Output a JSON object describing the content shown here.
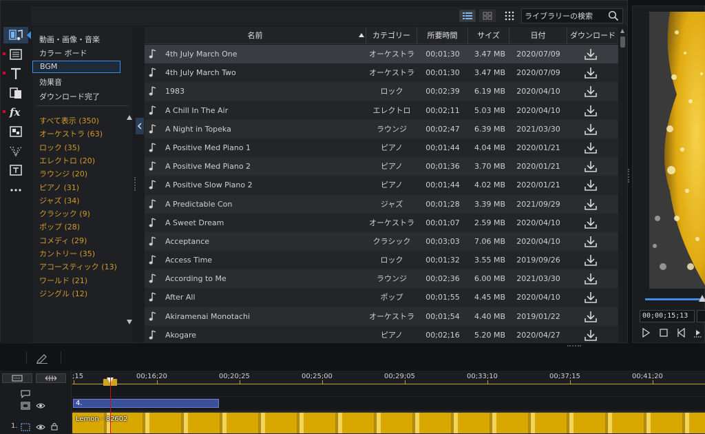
{
  "search": {
    "placeholder": "ライブラリーの検索"
  },
  "categories": {
    "main": [
      "動画・画像・音楽",
      "カラー ボード",
      "BGM",
      "効果音",
      "ダウンロード完了"
    ],
    "selected_index": 2,
    "genres": [
      "すべて表示 (350)",
      "オーケストラ (63)",
      "ロック (35)",
      "エレクトロ (20)",
      "ラウンジ (20)",
      "ピアノ (31)",
      "ジャズ (34)",
      "クラシック (9)",
      "ポップ (28)",
      "コメディ (29)",
      "カントリー (35)",
      "アコースティック (13)",
      "ワールド (21)",
      "ジングル (12)"
    ]
  },
  "table": {
    "headers": {
      "name": "名前",
      "category": "カテゴリー",
      "duration": "所要時間",
      "size": "サイズ",
      "date": "日付",
      "download": "ダウンロード"
    },
    "rows": [
      {
        "name": "4th July March One",
        "category": "オーケストラ",
        "duration": "00;01;30",
        "size": "3.47 MB",
        "date": "2020/07/09"
      },
      {
        "name": "4th July March Two",
        "category": "オーケストラ",
        "duration": "00;01;30",
        "size": "3.47 MB",
        "date": "2020/07/09"
      },
      {
        "name": "1983",
        "category": "ロック",
        "duration": "00;02;39",
        "size": "6.19 MB",
        "date": "2020/04/10"
      },
      {
        "name": "A Chill In The Air",
        "category": "エレクトロ",
        "duration": "00;02;11",
        "size": "5.03 MB",
        "date": "2020/04/10"
      },
      {
        "name": "A Night in Topeka",
        "category": "ラウンジ",
        "duration": "00;02;47",
        "size": "6.39 MB",
        "date": "2021/03/30"
      },
      {
        "name": "A Positive Med Piano 1",
        "category": "ピアノ",
        "duration": "00;01;44",
        "size": "4.04 MB",
        "date": "2020/01/21"
      },
      {
        "name": "A Positive Med Piano 2",
        "category": "ピアノ",
        "duration": "00;01;36",
        "size": "3.70 MB",
        "date": "2020/01/21"
      },
      {
        "name": "A Positive Slow Piano 2",
        "category": "ピアノ",
        "duration": "00;01;44",
        "size": "4.02 MB",
        "date": "2020/01/21"
      },
      {
        "name": "A Predictable Con",
        "category": "ジャズ",
        "duration": "00;01;28",
        "size": "3.39 MB",
        "date": "2021/09/29"
      },
      {
        "name": "A Sweet Dream",
        "category": "オーケストラ",
        "duration": "00;01;07",
        "size": "2.59 MB",
        "date": "2020/04/10"
      },
      {
        "name": "Acceptance",
        "category": "クラシック",
        "duration": "00;03;03",
        "size": "7.06 MB",
        "date": "2020/04/10"
      },
      {
        "name": "Access Time",
        "category": "ロック",
        "duration": "00;01;32",
        "size": "3.55 MB",
        "date": "2019/09/26"
      },
      {
        "name": "According to Me",
        "category": "ラウンジ",
        "duration": "00;02;36",
        "size": "6.00 MB",
        "date": "2021/03/30"
      },
      {
        "name": "After All",
        "category": "ポップ",
        "duration": "00;01;55",
        "size": "4.45 MB",
        "date": "2020/04/10"
      },
      {
        "name": "Akiramenai Monotachi",
        "category": "オーケストラ",
        "duration": "00;01;54",
        "size": "4.40 MB",
        "date": "2019/01/22"
      },
      {
        "name": "Akogare",
        "category": "ピアノ",
        "duration": "00;02;16",
        "size": "5.20 MB",
        "date": "2020/04/27"
      }
    ]
  },
  "preview": {
    "timecode": "00;00;15;13"
  },
  "timeline": {
    "ruler_labels": [
      ";15",
      "00;16;20",
      "00;20;25",
      "00;25;00",
      "00;29;05",
      "00;33;10",
      "00;37;15",
      "00;41;20"
    ],
    "track_number": "1.",
    "blue_clip_label": "4.",
    "video_clip_label": "Lemon - 82602"
  },
  "colors": {
    "accent": "#3d8ee6",
    "genre_text": "#d39a2b",
    "marker_red": "#c8102e"
  }
}
